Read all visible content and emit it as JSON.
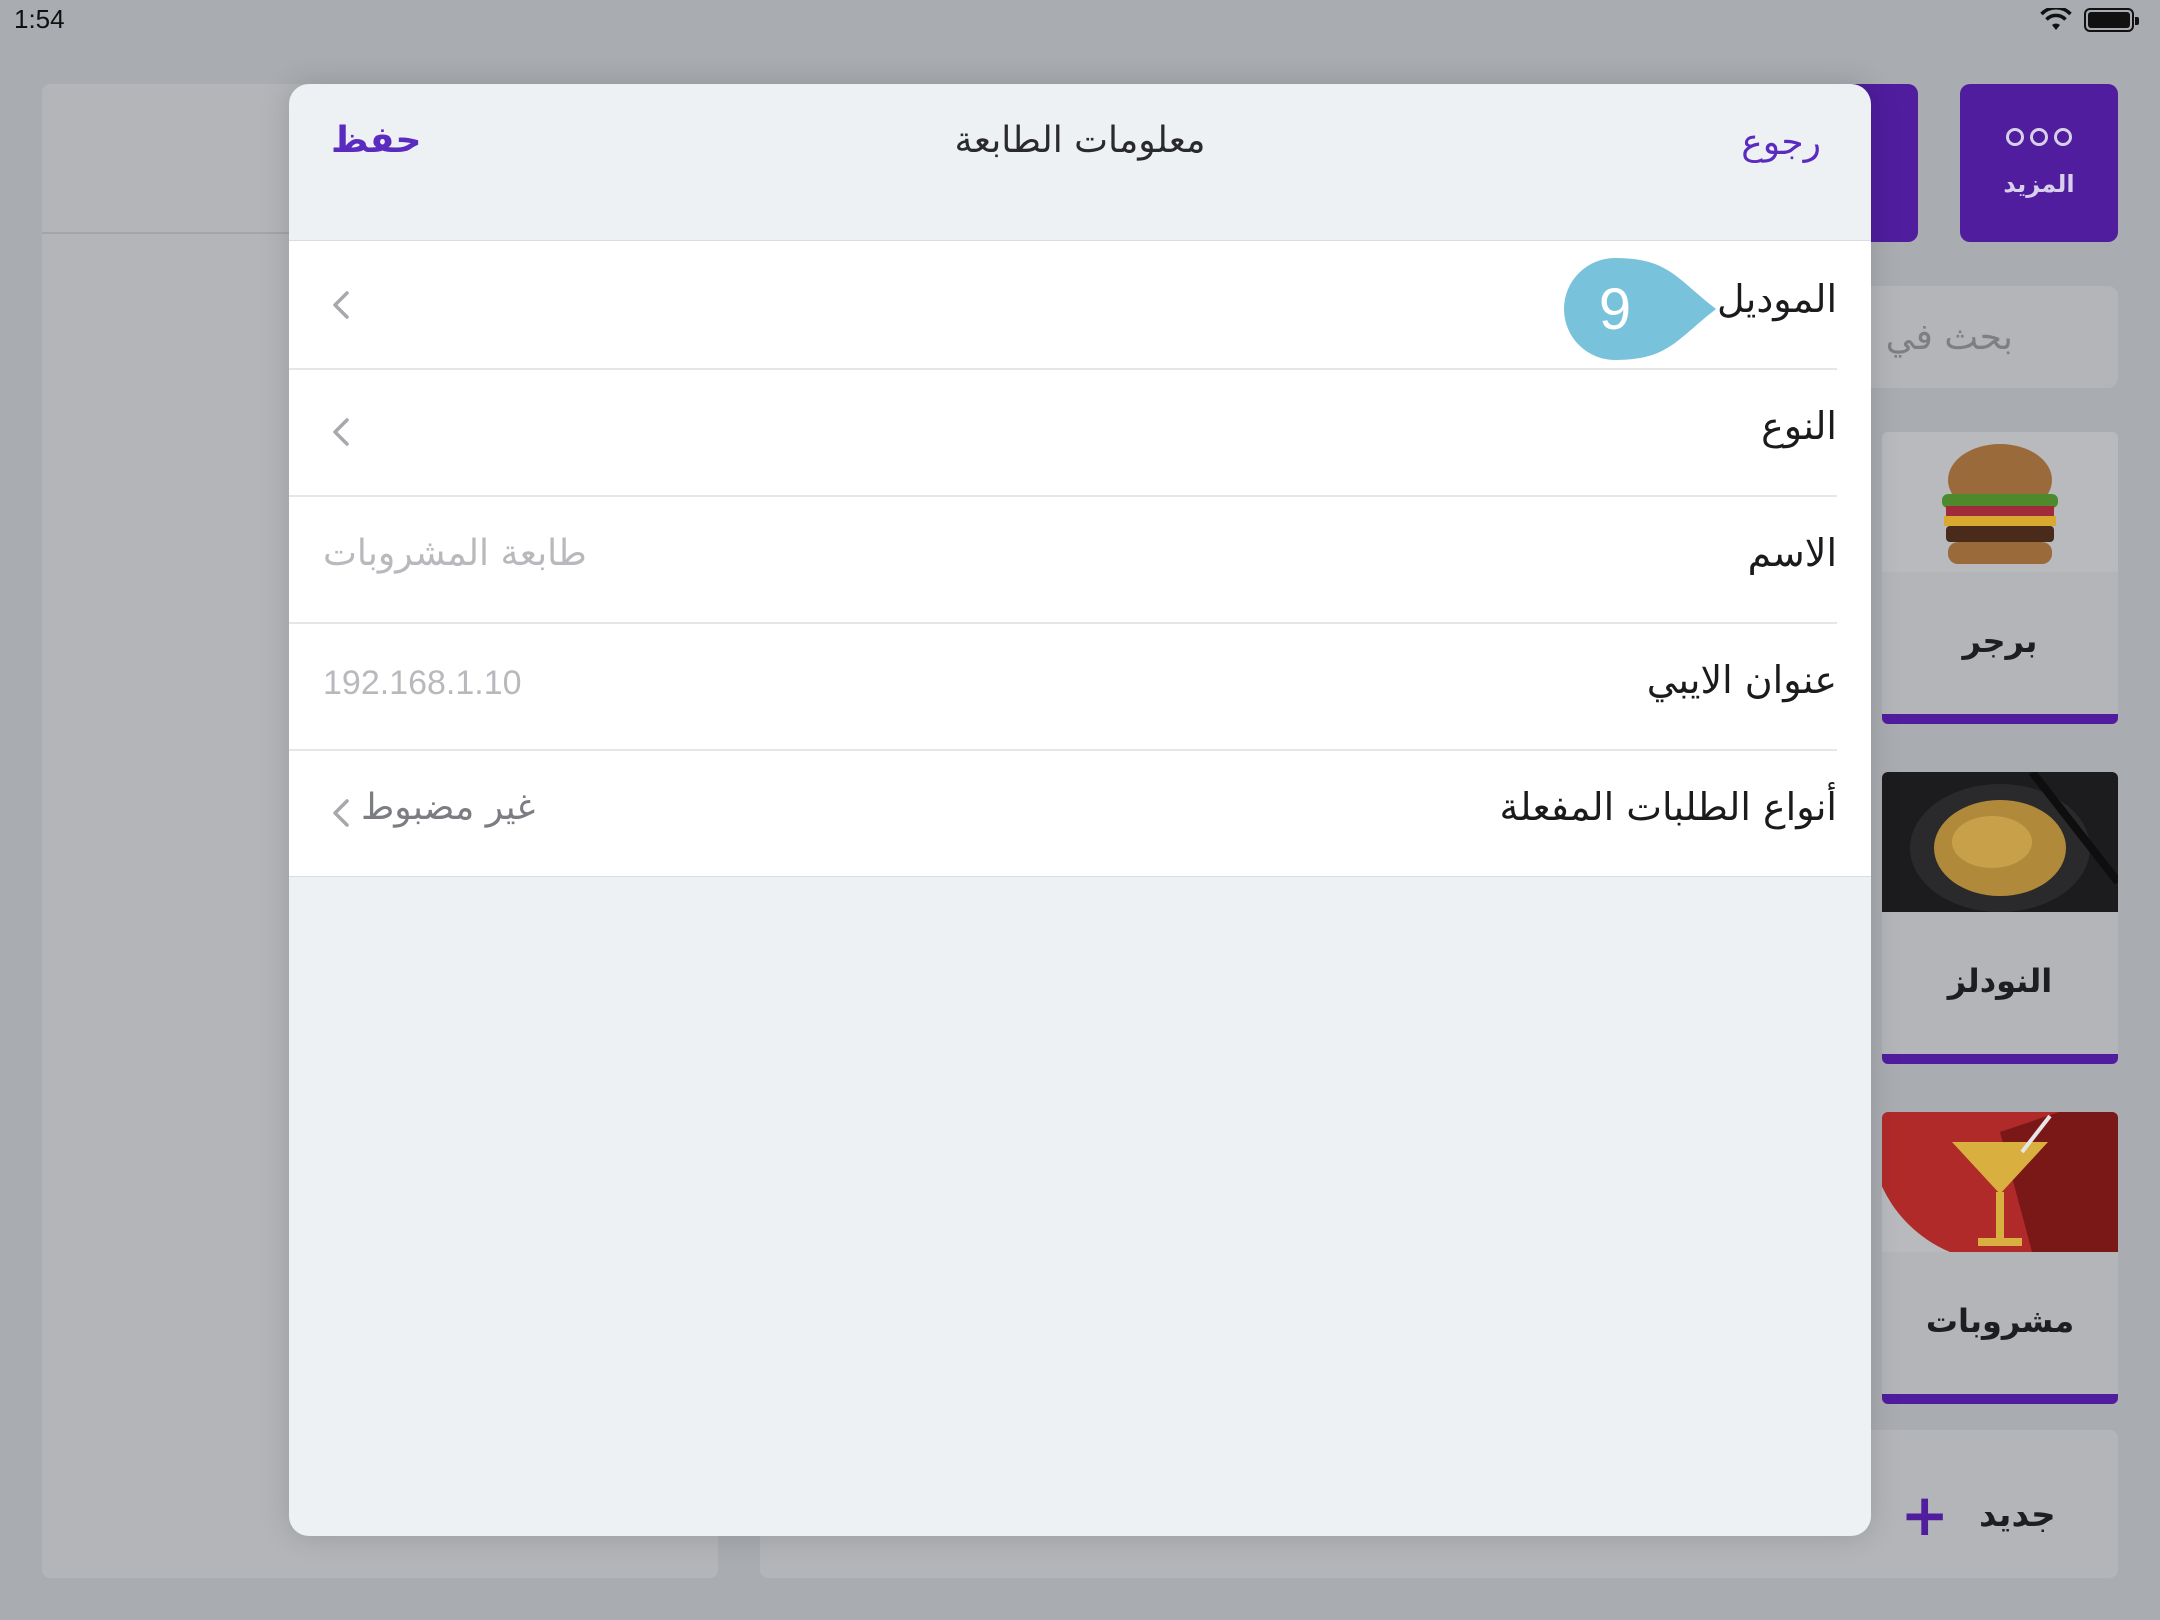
{
  "status_bar": {
    "time": "1:54"
  },
  "background": {
    "more_button": {
      "label": "المزيد",
      "icon": "more-dots-icon"
    },
    "search_placeholder": "بحث في ال",
    "categories": [
      {
        "name": "برجر",
        "icon": "burger-image"
      },
      {
        "name": "النودلز",
        "icon": "noodles-image"
      },
      {
        "name": "مشروبات",
        "icon": "drink-image"
      }
    ],
    "new_button": {
      "label": "جديد",
      "icon": "plus-icon"
    },
    "accent_color": "#4f1d9e"
  },
  "modal": {
    "title": "معلومات الطابعة",
    "save_label": "حفظ",
    "back_label": "رجوع",
    "rows": [
      {
        "label": "الموديل",
        "value": ""
      },
      {
        "label": "النوع",
        "value": ""
      },
      {
        "label": "الاسم",
        "value": "طابعة المشروبات"
      },
      {
        "label": "عنوان الايبي",
        "value": "192.168.1.10"
      },
      {
        "label": "أنواع الطلبات المفعلة",
        "value": "غير مضبوط"
      }
    ],
    "link_color": "#5b2bc0"
  },
  "callout": {
    "number": "9",
    "color": "#79c2dc"
  }
}
